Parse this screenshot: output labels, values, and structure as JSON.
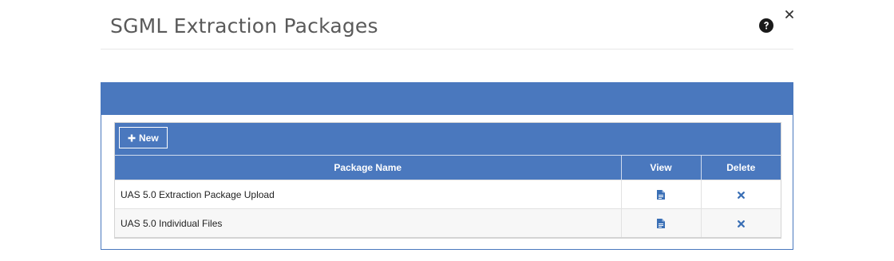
{
  "dialog": {
    "title": "SGML Extraction Packages",
    "help_icon": "question-circle-icon",
    "close_icon": "close-icon"
  },
  "toolbar": {
    "new_label": "New",
    "new_icon": "plus-icon"
  },
  "table": {
    "columns": [
      "Package Name",
      "View",
      "Delete"
    ],
    "rows": [
      {
        "name": "UAS 5.0 Extraction Package Upload",
        "view_icon": "document-icon",
        "delete_icon": "delete-x-icon"
      },
      {
        "name": "UAS 5.0 Individual Files",
        "view_icon": "document-icon",
        "delete_icon": "delete-x-icon"
      }
    ]
  },
  "colors": {
    "primary": "#4a78be",
    "icon_blue": "#3a6fb5",
    "title_text": "#5a5a5a"
  }
}
